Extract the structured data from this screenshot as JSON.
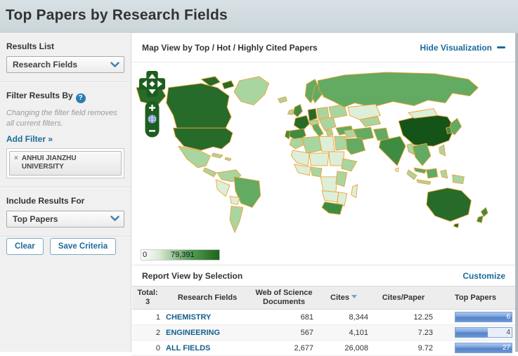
{
  "page": {
    "title": "Top Papers by Research Fields"
  },
  "sidebar": {
    "results_list_label": "Results List",
    "results_list_value": "Research Fields",
    "filter_by_label": "Filter Results By",
    "filter_note": "Changing the filter field removes all current filters.",
    "add_filter_label": "Add Filter »",
    "filter_remove_icon": "×",
    "filters": [
      {
        "label": "ANHUI JIANZHU UNIVERSITY"
      }
    ],
    "include_label": "Include Results For",
    "include_value": "Top Papers",
    "clear_label": "Clear",
    "save_label": "Save Criteria",
    "help_glyph": "?"
  },
  "map_panel": {
    "title": "Map View by Top / Hot / Highly Cited Papers",
    "hide_label": "Hide Visualization",
    "controls": {
      "zoom_in": "+",
      "zoom_out": "−"
    },
    "legend": {
      "min": "0",
      "max": "79,391"
    },
    "border_color": "#efa233",
    "palette": {
      "l1": "#ddefd8",
      "l2": "#a9d5a1",
      "l3": "#63aa63",
      "l4": "#3e8c42",
      "l5": "#266b29",
      "l6": "#155418"
    },
    "regions": [
      {
        "id": "greenland",
        "level": "l2"
      },
      {
        "id": "iceland",
        "level": "l2"
      },
      {
        "id": "arctic1",
        "level": "l5"
      },
      {
        "id": "arctic2",
        "level": "l5"
      },
      {
        "id": "alaska",
        "level": "l5"
      },
      {
        "id": "canada",
        "level": "l5"
      },
      {
        "id": "usa",
        "level": "l5"
      },
      {
        "id": "mexico",
        "level": "l2"
      },
      {
        "id": "cuba",
        "level": "l2"
      },
      {
        "id": "hispaniola",
        "level": "l2"
      },
      {
        "id": "camerica",
        "level": "l2"
      },
      {
        "id": "colombia",
        "level": "l2"
      },
      {
        "id": "brazil",
        "level": "l3"
      },
      {
        "id": "peru",
        "level": "l1"
      },
      {
        "id": "bolivia",
        "level": "l1"
      },
      {
        "id": "argentina",
        "level": "l2"
      },
      {
        "id": "uk",
        "level": "l4"
      },
      {
        "id": "ireland",
        "level": "l2"
      },
      {
        "id": "norway",
        "level": "l3"
      },
      {
        "id": "sweden",
        "level": "l3"
      },
      {
        "id": "finland",
        "level": "l2"
      },
      {
        "id": "france",
        "level": "l5"
      },
      {
        "id": "spain",
        "level": "l4"
      },
      {
        "id": "portugal",
        "level": "l4"
      },
      {
        "id": "germany",
        "level": "l5"
      },
      {
        "id": "italy",
        "level": "l3"
      },
      {
        "id": "alpine",
        "level": "l2"
      },
      {
        "id": "poland",
        "level": "l2"
      },
      {
        "id": "balkans",
        "level": "l2"
      },
      {
        "id": "greece",
        "level": "l2"
      },
      {
        "id": "ukraine",
        "level": "l2"
      },
      {
        "id": "turkey",
        "level": "l3"
      },
      {
        "id": "russia",
        "level": "l3"
      },
      {
        "id": "kazakhstan",
        "level": "l1"
      },
      {
        "id": "centralasia",
        "level": "l2"
      },
      {
        "id": "iran",
        "level": "l3"
      },
      {
        "id": "iraq",
        "level": "l2"
      },
      {
        "id": "saudi",
        "level": "l3"
      },
      {
        "id": "afpak",
        "level": "l3"
      },
      {
        "id": "india",
        "level": "l4"
      },
      {
        "id": "srilanka",
        "level": "l1"
      },
      {
        "id": "china",
        "level": "l6"
      },
      {
        "id": "mongolia",
        "level": "l1"
      },
      {
        "id": "japan",
        "level": "l3"
      },
      {
        "id": "korea",
        "level": "l4"
      },
      {
        "id": "seasia",
        "level": "l3"
      },
      {
        "id": "myanmar",
        "level": "l2"
      },
      {
        "id": "philippines",
        "level": "l2"
      },
      {
        "id": "malaysia",
        "level": "l3"
      },
      {
        "id": "sumatra",
        "level": "l2"
      },
      {
        "id": "java",
        "level": "l2"
      },
      {
        "id": "borneo",
        "level": "l3"
      },
      {
        "id": "sulawesi",
        "level": "l2"
      },
      {
        "id": "png",
        "level": "l2"
      },
      {
        "id": "australia",
        "level": "l5"
      },
      {
        "id": "tasmania",
        "level": "l5"
      },
      {
        "id": "nz1",
        "level": "l4"
      },
      {
        "id": "nz2",
        "level": "l4"
      },
      {
        "id": "morocco",
        "level": "l2"
      },
      {
        "id": "algeria",
        "level": "l2"
      },
      {
        "id": "libya",
        "level": "l1"
      },
      {
        "id": "egypt",
        "level": "l2"
      },
      {
        "id": "mauritania",
        "level": "l1"
      },
      {
        "id": "niger",
        "level": "l1"
      },
      {
        "id": "sudan",
        "level": "l1"
      },
      {
        "id": "wafrica",
        "level": "l1"
      },
      {
        "id": "nigeria",
        "level": "l2"
      },
      {
        "id": "ethiopia",
        "level": "l2"
      },
      {
        "id": "drc",
        "level": "l1"
      },
      {
        "id": "kenya",
        "level": "l2"
      },
      {
        "id": "angola",
        "level": "l1"
      },
      {
        "id": "mozambique",
        "level": "l1"
      },
      {
        "id": "southafrica",
        "level": "l4"
      },
      {
        "id": "madagascar",
        "level": "l1"
      }
    ]
  },
  "report": {
    "title": "Report View by Selection",
    "customize_label": "Customize",
    "total_label": "Total:",
    "total_value": "3",
    "columns": {
      "field": "Research Fields",
      "docs": "Web of Science Documents",
      "cites": "Cites",
      "cpp": "Cites/Paper",
      "top": "Top Papers"
    },
    "sorted_column": "cites",
    "rows": [
      {
        "rank": "1",
        "field": "CHEMISTRY",
        "docs": "681",
        "cites": "8,344",
        "cpp": "12.25",
        "top_papers": "6",
        "bar_pct": 100
      },
      {
        "rank": "2",
        "field": "ENGINEERING",
        "docs": "567",
        "cites": "4,101",
        "cpp": "7.23",
        "top_papers": "4",
        "bar_pct": 58
      },
      {
        "rank": "0",
        "field": "ALL FIELDS",
        "docs": "2,677",
        "cites": "26,008",
        "cpp": "9.72",
        "top_papers": "27",
        "bar_pct": 100
      }
    ]
  },
  "colors": {
    "link_blue": "#1b6a9b",
    "banner_bg": "#cdd8dc",
    "bar_fill": "#5583c8",
    "map_control_green": "#1d5e20"
  }
}
